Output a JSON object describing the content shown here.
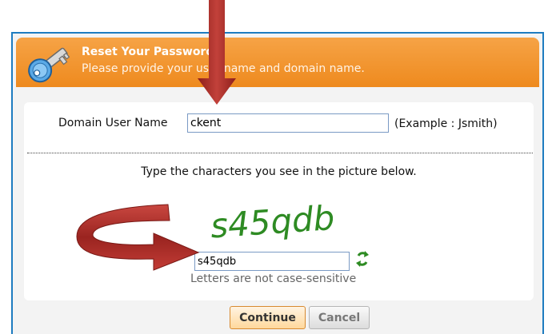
{
  "header": {
    "title": "Reset Your Password",
    "subtitle": "Please provide your user name and domain name."
  },
  "form": {
    "username_label": "Domain User Name",
    "username_value": "ckent",
    "example_text": "(Example : Jsmith)",
    "captcha_instruction": "Type the characters you see in the picture below.",
    "captcha_image_text": "s45qdb",
    "captcha_value": "s45qdb",
    "captcha_note": "Letters are not case-sensitive"
  },
  "buttons": {
    "continue_label": "Continue",
    "cancel_label": "Cancel"
  },
  "colors": {
    "header_orange": "#ef8c22",
    "frame_blue": "#1e7cc0",
    "annotation_red": "#b4322c",
    "captcha_green": "#2e8b23"
  },
  "icons": [
    "key-icon",
    "refresh-icon"
  ]
}
